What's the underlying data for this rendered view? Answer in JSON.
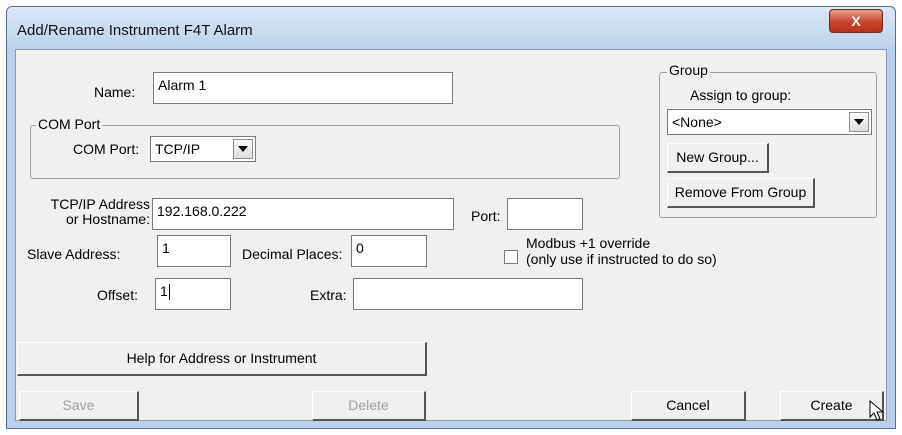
{
  "window": {
    "title": "Add/Rename Instrument F4T Alarm",
    "close_glyph": "X"
  },
  "form": {
    "name_label": "Name:",
    "name_value": "Alarm 1",
    "com_port_group_label": "COM Port",
    "com_port_label": "COM Port:",
    "com_port_value": "TCP/IP",
    "tcpip_label_line1": "TCP/IP Address",
    "tcpip_label_line2": "or Hostname:",
    "tcpip_value": "192.168.0.222",
    "port_label": "Port:",
    "port_value": "",
    "slave_label": "Slave Address:",
    "slave_value": "1",
    "decimal_label": "Decimal Places:",
    "decimal_value": "0",
    "modbus_line1": "Modbus +1 override",
    "modbus_line2": "(only use if instructed to do so)",
    "modbus_checked": false,
    "offset_label": "Offset:",
    "offset_value": "1",
    "extra_label": "Extra:",
    "extra_value": ""
  },
  "group": {
    "legend": "Group",
    "assign_label": "Assign to group:",
    "selected": "<None>",
    "new_group_button": "New Group...",
    "remove_button": "Remove From Group"
  },
  "buttons": {
    "help": "Help for Address or  Instrument",
    "save": "Save",
    "delete": "Delete",
    "cancel": "Cancel",
    "create": "Create"
  }
}
